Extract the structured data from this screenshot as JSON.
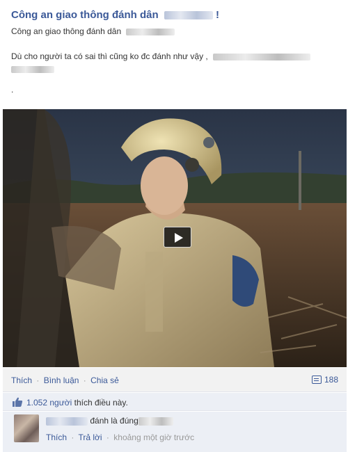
{
  "post": {
    "title": "Công an giao thông đánh dân",
    "title_suffix": "!",
    "subtitle": "Công an giao thông đánh dân",
    "body": "Dù cho người ta có sai thì cũng ko đc đánh như vậy ,",
    "trailing": "."
  },
  "video": {
    "play_icon": "play-icon"
  },
  "actions": {
    "like": "Thích",
    "comment": "Bình luận",
    "share": "Chia sẻ",
    "separator": "·",
    "comment_count": "188",
    "comment_icon": "comment-bubble-icon"
  },
  "likes": {
    "count": "1.052 người",
    "suffix": "thích điều này.",
    "icon": "thumbs-up-icon"
  },
  "comment": {
    "text": "đánh là đúng",
    "like": "Thích",
    "reply": "Trả lời",
    "time": "khoảng một giờ trước"
  },
  "colors": {
    "link": "#3b5998",
    "action_bar": "#f2f2f2",
    "comment_bg": "#eceff5"
  }
}
